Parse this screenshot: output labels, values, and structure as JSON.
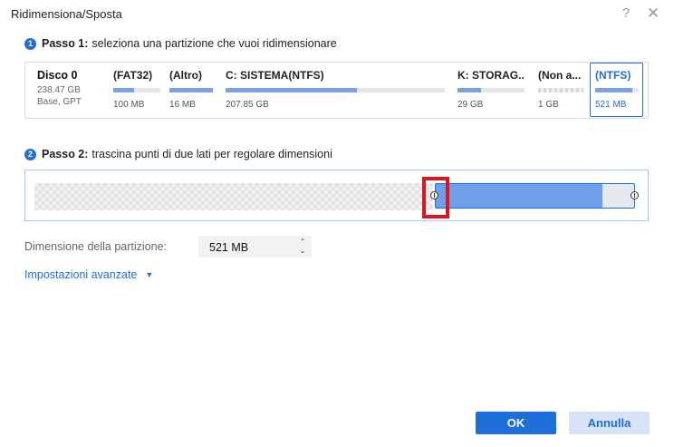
{
  "window": {
    "title": "Ridimensiona/Sposta",
    "help_label": "?",
    "close_label": "✕"
  },
  "step1": {
    "number": "1",
    "label": "Passo 1:",
    "text": "seleziona una partizione che vuoi ridimensionare"
  },
  "disk": {
    "name": "Disco 0",
    "size": "238.47 GB",
    "type": "Base, GPT"
  },
  "partitions": [
    {
      "label": "(FAT32)",
      "size": "100 MB",
      "usage": 0.45
    },
    {
      "label": "(Altro)",
      "size": "16 MB",
      "usage": 1.0
    },
    {
      "label": "C: SISTEMA(NTFS)",
      "size": "207.85 GB",
      "usage": 0.6
    },
    {
      "label": "K: STORAG...",
      "size": "29 GB",
      "usage": 0.35
    },
    {
      "label": "(Non a...",
      "size": "1 GB",
      "usage": 0
    },
    {
      "label": "(NTFS)",
      "size": "521 MB",
      "usage": 0.85,
      "selected": true
    }
  ],
  "step2": {
    "number": "2",
    "label": "Passo 2:",
    "text": "trascina punti di due lati per regolare dimensioni"
  },
  "resize": {
    "used_fraction": 0.84
  },
  "partition_size": {
    "label": "Dimensione della partizione:",
    "value": "521 MB",
    "up": "⌃",
    "down": "⌄"
  },
  "advanced": {
    "label": "Impostazioni avanzate",
    "caret": "▼"
  },
  "buttons": {
    "ok": "OK",
    "cancel": "Annulla"
  },
  "colors": {
    "accent": "#1e6fd9",
    "used_fill": "#6f9eea",
    "highlight": "#e0141e"
  }
}
